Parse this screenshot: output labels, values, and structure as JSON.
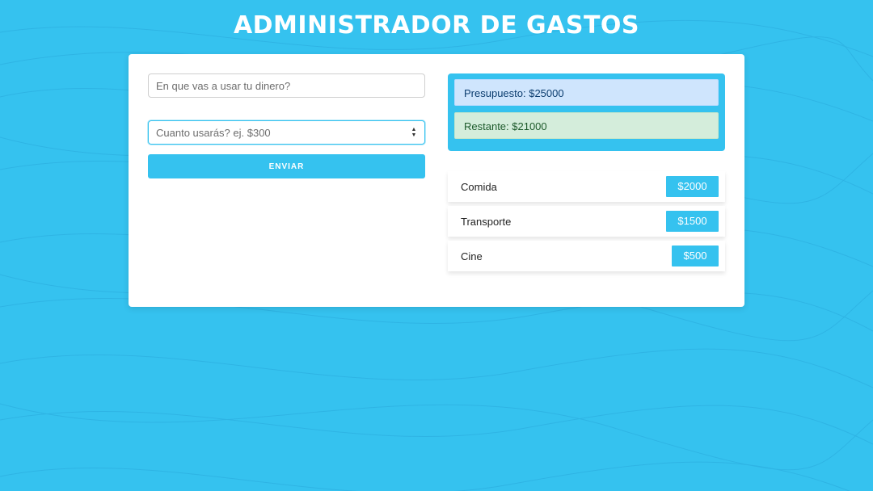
{
  "header": {
    "title": "ADMINISTRADOR DE GASTOS"
  },
  "form": {
    "name_placeholder": "En que vas a usar tu dinero?",
    "amount_placeholder": "Cuanto usarás? ej. $300",
    "submit_label": "ENVIAR"
  },
  "summary": {
    "budget": "Presupuesto: $25000",
    "remaining": "Restante: $21000"
  },
  "expenses": [
    {
      "name": "Comida",
      "amount": "$2000"
    },
    {
      "name": "Transporte",
      "amount": "$1500"
    },
    {
      "name": "Cine",
      "amount": "$500"
    }
  ],
  "colors": {
    "accent": "#35c2ef",
    "budget_bg": "#cfe5fd",
    "remaining_bg": "#d4eddb"
  }
}
